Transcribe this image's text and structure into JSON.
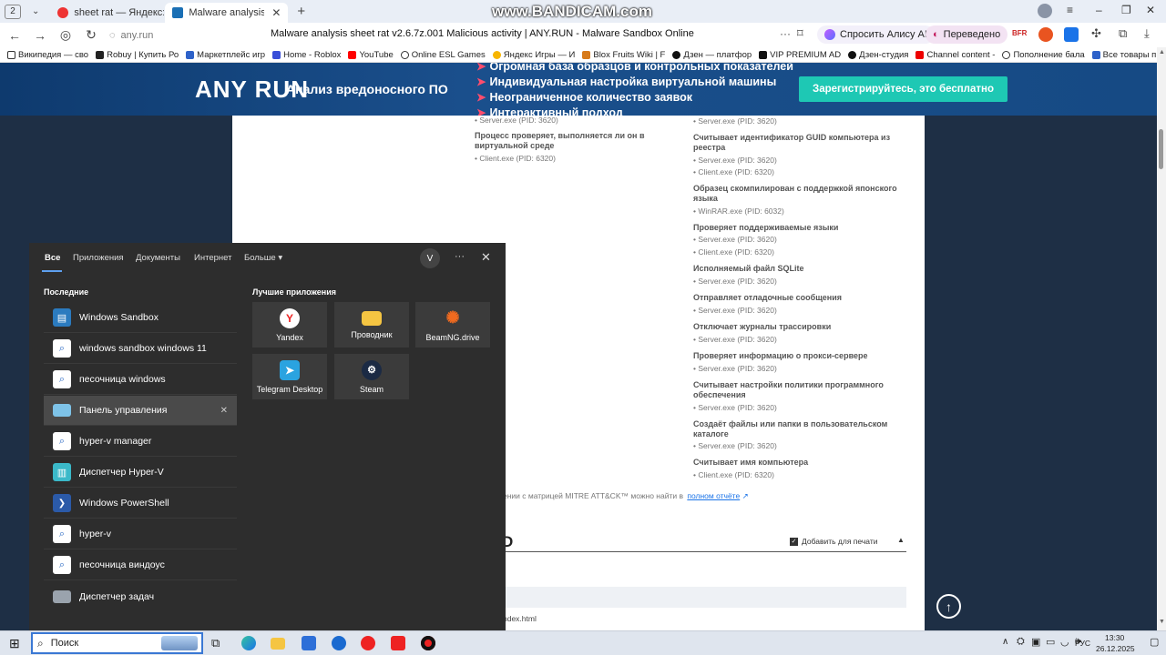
{
  "browser": {
    "tab_count": "2",
    "tabs": [
      {
        "label": "sheet rat — Яндекс: нашл"
      },
      {
        "label": "Malware analysis sheet"
      }
    ],
    "address": "any.run",
    "page_title": "Malware analysis sheet rat v2.6.7z.001 Malicious activity | ANY.RUN - Malware Sandbox Online",
    "alice": "Спросить Алису AI",
    "translated": "Переведено",
    "watermark": "www.BANDICAM.com",
    "bookmarks": [
      "Википедия — сво",
      "Robuy | Купить Ро",
      "Маркетплейс игр",
      "Home - Roblox",
      "YouTube",
      "Online ESL Games",
      "Яндекс Игры — И",
      "Blox Fruits Wiki | F",
      "Дзен — платфор",
      "VIP PREMIUM AD",
      "Дзен-студия",
      "Channel content -",
      "Пополнение бала",
      "Все товары прод"
    ]
  },
  "banner": {
    "logo": "ANY RUN",
    "tagline": "Анализ вредоносного ПО",
    "features": [
      "Огромная база образцов и контрольных показателей",
      "Индивидуальная настройка виртуальной машины",
      "Неограниченное количество заявок",
      "Интерактивный подход"
    ],
    "register": "Зарегистрируйтесь, это бесплатно"
  },
  "content": {
    "left": [
      {
        "proc": "Server.exe (PID: 3620)"
      },
      {
        "head": "Процесс проверяет, выполняется ли он в виртуальной среде",
        "procs": [
          "Client.exe (PID: 6320)"
        ]
      }
    ],
    "right_top": "Server.exe (PID: 3620)",
    "right": [
      {
        "head": "Считывает идентификатор GUID компьютера из реестра",
        "procs": [
          "Server.exe (PID: 3620)",
          "Client.exe (PID: 6320)"
        ]
      },
      {
        "head": "Образец скомпилирован с поддержкой японского языка",
        "procs": [
          "WinRAR.exe (PID: 6032)"
        ]
      },
      {
        "head": "Проверяет поддерживаемые языки",
        "procs": [
          "Server.exe (PID: 3620)",
          "Client.exe (PID: 6320)"
        ]
      },
      {
        "head": "Исполняемый файл SQLite",
        "procs": [
          "Server.exe (PID: 3620)"
        ]
      },
      {
        "head": "Отправляет отладочные сообщения",
        "procs": [
          "Server.exe (PID: 3620)"
        ]
      },
      {
        "head": "Отключает журналы трассировки",
        "procs": [
          "Server.exe (PID: 3620)"
        ]
      },
      {
        "head": "Проверяет информацию о прокси-сервере",
        "procs": [
          "Server.exe (PID: 3620)"
        ]
      },
      {
        "head": "Считывает настройки политики программного обеспечения",
        "procs": [
          "Server.exe (PID: 3620)"
        ]
      },
      {
        "head": "Создаёт файлы или папки в пользовательском каталоге",
        "procs": [
          "Server.exe (PID: 3620)"
        ]
      },
      {
        "head": "Считывает имя компьютера",
        "procs": [
          "Client.exe (PID: 6320)"
        ]
      }
    ],
    "mitre_note": "ении с матрицей MITRE ATT&CK™ можно найти в",
    "mitre_link": "полном отчёте",
    "section_fragment": "D",
    "print_label": "Добавить для печати",
    "file_fragment": "ndex.html"
  },
  "startmenu": {
    "tabs": [
      "Все",
      "Приложения",
      "Документы",
      "Интернет",
      "Больше"
    ],
    "avatar": "V",
    "recent_title": "Последние",
    "recent": [
      "Windows Sandbox",
      "windows sandbox windows 11",
      "песочница windows",
      "Панель управления",
      "hyper-v manager",
      "Диспетчер Hyper-V",
      "Windows PowerShell",
      "hyper-v",
      "песочница виндоус",
      "Диспетчер задач"
    ],
    "top_title": "Лучшие приложения",
    "apps": [
      "Yandex",
      "Проводник",
      "BeamNG.drive",
      "Telegram Desktop",
      "Steam"
    ]
  },
  "taskbar": {
    "search_placeholder": "Поиск",
    "lang": "РУС",
    "time": "13:30",
    "date": "26.12.2025"
  }
}
